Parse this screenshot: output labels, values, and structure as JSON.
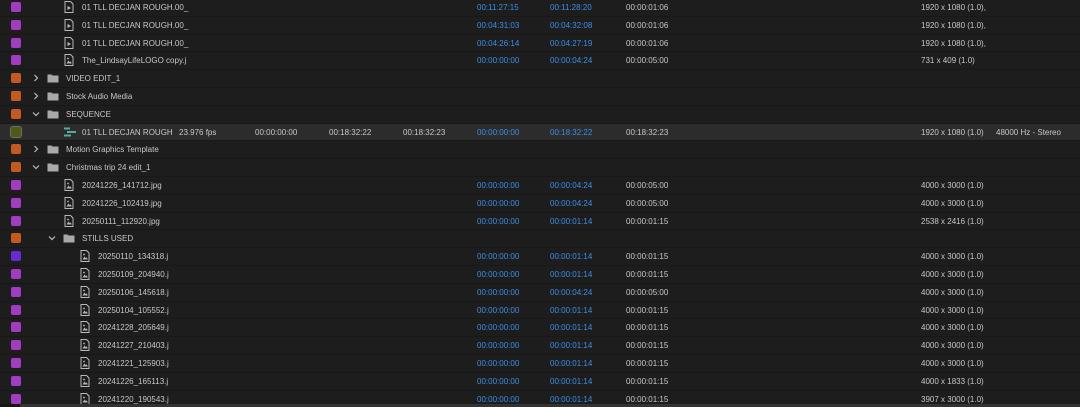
{
  "colors": {
    "label_violet": "#a03cc0",
    "label_orange": "#c25a22",
    "label_olive": "#4f5a18",
    "label_deep_violet": "#6a2ad0",
    "timecode_blue": "#3c8fe8"
  },
  "rows": [
    {
      "label": "violet",
      "indent": 1,
      "kind": "file-video",
      "name": "01 TLL DECJAN ROUGH.00_",
      "in": "00:11:27:15",
      "out": "00:11:28:20",
      "dur": "00:00:01:06",
      "res": "1920 x 1080 (1.0),"
    },
    {
      "label": "violet",
      "indent": 1,
      "kind": "file-video",
      "name": "01 TLL DECJAN ROUGH.00_",
      "in": "00:04:31:03",
      "out": "00:04:32:08",
      "dur": "00:00:01:06",
      "res": "1920 x 1080 (1.0),"
    },
    {
      "label": "violet",
      "indent": 1,
      "kind": "file-video",
      "name": "01 TLL DECJAN ROUGH.00_",
      "in": "00:04:26:14",
      "out": "00:04:27:19",
      "dur": "00:00:01:06",
      "res": "1920 x 1080 (1.0),"
    },
    {
      "label": "violet",
      "indent": 1,
      "kind": "file-image",
      "name": "The_LindsayLifeLOGO copy.j",
      "in": "00:00:00:00",
      "out": "00:00:04:24",
      "dur": "00:00:05:00",
      "res": "731 x 409 (1.0)"
    },
    {
      "label": "orange",
      "indent": 0,
      "kind": "bin",
      "chevron": "right",
      "name": "VIDEO EDIT_1"
    },
    {
      "label": "orange",
      "indent": 0,
      "kind": "bin",
      "chevron": "right",
      "name": "Stock Audio Media"
    },
    {
      "label": "orange",
      "indent": 0,
      "kind": "bin",
      "chevron": "down",
      "name": "SEQUENCE"
    },
    {
      "label": "olive",
      "indent": 1,
      "kind": "sequence",
      "name": "01 TLL DECJAN ROUGH",
      "selected": true,
      "fps": "23.976 fps",
      "media_start": "00:00:00:00",
      "media_end": "00:18:32:22",
      "media_dur": "00:18:32:23",
      "in": "00:00:00:00",
      "out": "00:18:32:22",
      "dur": "00:18:32:23",
      "res": "1920 x 1080 (1.0)",
      "audio": "48000 Hz - Stereo"
    },
    {
      "label": "orange",
      "indent": 0,
      "kind": "bin",
      "chevron": "right",
      "name": "Motion Graphics Template"
    },
    {
      "label": "orange",
      "indent": 0,
      "kind": "bin",
      "chevron": "down",
      "name": "Christmas trip 24 edit_1"
    },
    {
      "label": "violet",
      "indent": 1,
      "kind": "file-image",
      "name": "20241226_141712.jpg",
      "in": "00:00:00:00",
      "out": "00:00:04:24",
      "dur": "00:00:05:00",
      "res": "4000 x 3000 (1.0)"
    },
    {
      "label": "violet",
      "indent": 1,
      "kind": "file-image",
      "name": "20241226_102419.jpg",
      "in": "00:00:00:00",
      "out": "00:00:04:24",
      "dur": "00:00:05:00",
      "res": "4000 x 3000 (1.0)"
    },
    {
      "label": "violet",
      "indent": 1,
      "kind": "file-image",
      "name": "20250111_112920.jpg",
      "in": "00:00:00:00",
      "out": "00:00:01:14",
      "dur": "00:00:01:15",
      "res": "2538 x 2416 (1.0)"
    },
    {
      "label": "orange",
      "indent": 1,
      "kind": "bin",
      "chevron": "down",
      "name": "STILLS USED"
    },
    {
      "label": "deep_violet",
      "indent": 2,
      "kind": "file-image",
      "name": "20250110_134318.j",
      "in": "00:00:00:00",
      "out": "00:00:01:14",
      "dur": "00:00:01:15",
      "res": "4000 x 3000 (1.0)"
    },
    {
      "label": "violet",
      "indent": 2,
      "kind": "file-image",
      "name": "20250109_204940.j",
      "in": "00:00:00:00",
      "out": "00:00:01:14",
      "dur": "00:00:01:15",
      "res": "4000 x 3000 (1.0)"
    },
    {
      "label": "violet",
      "indent": 2,
      "kind": "file-image",
      "name": "20250106_145618.j",
      "in": "00:00:00:00",
      "out": "00:00:04:24",
      "dur": "00:00:05:00",
      "res": "4000 x 3000 (1.0)"
    },
    {
      "label": "violet",
      "indent": 2,
      "kind": "file-image",
      "name": "20250104_105552.j",
      "in": "00:00:00:00",
      "out": "00:00:01:14",
      "dur": "00:00:01:15",
      "res": "4000 x 3000 (1.0)"
    },
    {
      "label": "violet",
      "indent": 2,
      "kind": "file-image",
      "name": "20241228_205649.j",
      "in": "00:00:00:00",
      "out": "00:00:01:14",
      "dur": "00:00:01:15",
      "res": "4000 x 3000 (1.0)"
    },
    {
      "label": "violet",
      "indent": 2,
      "kind": "file-image",
      "name": "20241227_210403.j",
      "in": "00:00:00:00",
      "out": "00:00:01:14",
      "dur": "00:00:01:15",
      "res": "4000 x 3000 (1.0)"
    },
    {
      "label": "violet",
      "indent": 2,
      "kind": "file-image",
      "name": "20241221_125903.j",
      "in": "00:00:00:00",
      "out": "00:00:01:14",
      "dur": "00:00:01:15",
      "res": "4000 x 3000 (1.0)"
    },
    {
      "label": "violet",
      "indent": 2,
      "kind": "file-image",
      "name": "20241226_165113.j",
      "in": "00:00:00:00",
      "out": "00:00:01:14",
      "dur": "00:00:01:15",
      "res": "4000 x 1833 (1.0)"
    },
    {
      "label": "violet",
      "indent": 2,
      "kind": "file-image",
      "name": "20241220_190543.j",
      "in": "00:00:00:00",
      "out": "00:00:01:14",
      "dur": "00:00:01:15",
      "res": "3907 x 3000 (1.0)"
    }
  ]
}
